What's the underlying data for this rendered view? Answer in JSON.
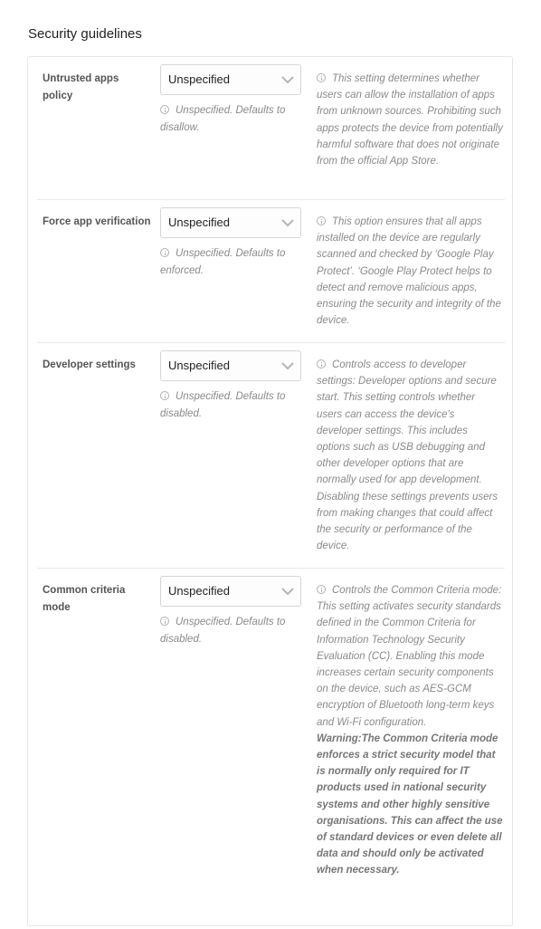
{
  "section": {
    "title": "Security guidelines"
  },
  "settings": [
    {
      "label": "Untrusted apps policy",
      "selected": "Unspecified",
      "hint": "Unspecified. Defaults to disallow.",
      "description": "This setting determines whether users can allow the installation of apps from unknown sources. Prohibiting such apps protects the device from potentially harmful software that does not originate from the official App Store."
    },
    {
      "label": "Force app verification",
      "selected": "Unspecified",
      "hint": "Unspecified. Defaults to enforced.",
      "description": "This option ensures that all apps installed on the device are regularly scanned and checked by ‘Google Play Protect’. ‘Google Play Protect helps to detect and remove malicious apps, ensuring the security and integrity of the device."
    },
    {
      "label": "Developer settings",
      "selected": "Unspecified",
      "hint": "Unspecified. Defaults to disabled.",
      "description": "Controls access to developer settings: Developer options and secure start. This setting controls whether users can access the device's developer settings. This includes options such as USB debugging and other developer options that are normally used for app development. Disabling these settings prevents users from making changes that could affect the security or performance of the device."
    },
    {
      "label": "Common criteria mode",
      "selected": "Unspecified",
      "hint": "Unspecified. Defaults to disabled.",
      "description": "Controls the Common Criteria mode: This setting activates security standards defined in the Common Criteria for Information Technology Security Evaluation (CC). Enabling this mode increases certain security components on the device, such as AES-GCM encryption of Bluetooth long-term keys and Wi-Fi configuration.",
      "warning": "Warning:The Common Criteria mode enforces a strict security model that is normally only required for IT products used in national security systems and other highly sensitive organisations. This can affect the use of standard devices or even delete all data and should only be activated when necessary."
    }
  ]
}
